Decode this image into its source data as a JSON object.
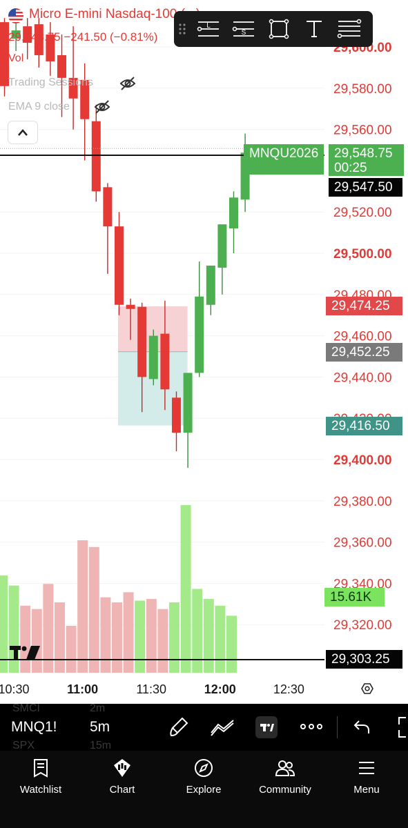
{
  "colors": {
    "up": "#4caf50",
    "down": "#e53935",
    "up_vol": "#a5ea8a",
    "down_vol": "#efb4b4",
    "axis_red": "#e03b36"
  },
  "legend": {
    "title": "Micro E-mini Nasdaq-100 (...)",
    "price_line": "29,548.75  −241.50 (−0.81%)",
    "vol": "Vol",
    "ind1": "Trading Sessions",
    "ind2": "EMA 9 close",
    "eye_icon": "eye-off-icon",
    "collapse_icon": "chevron-up-icon"
  },
  "toolbar_icons": [
    "grip-icon",
    "long-position-icon",
    "short-position-icon",
    "rectangle-icon",
    "text-icon",
    "fib-lines-icon"
  ],
  "chart_data": {
    "type": "candlestick",
    "price_axis": {
      "range": [
        29296,
        29614
      ],
      "ticks": [
        {
          "value": 29600,
          "label": "29,600.00",
          "bold": true
        },
        {
          "value": 29580,
          "label": "29,580.00",
          "bold": false
        },
        {
          "value": 29560,
          "label": "29,560.00",
          "bold": false
        },
        {
          "value": 29520,
          "label": "29,520.00",
          "bold": false
        },
        {
          "value": 29500,
          "label": "29,500.00",
          "bold": true
        },
        {
          "value": 29480,
          "label": "29,480.00",
          "bold": false
        },
        {
          "value": 29460,
          "label": "29,460.00",
          "bold": false
        },
        {
          "value": 29440,
          "label": "29,440.00",
          "bold": false
        },
        {
          "value": 29420,
          "label": "29,420.00",
          "bold": false
        },
        {
          "value": 29400,
          "label": "29,400.00",
          "bold": true
        },
        {
          "value": 29380,
          "label": "29,380.00",
          "bold": false
        },
        {
          "value": 29360,
          "label": "29,360.00",
          "bold": false
        },
        {
          "value": 29340,
          "label": "29,340.00",
          "bold": false
        },
        {
          "value": 29320,
          "label": "29,320.00",
          "bold": false
        }
      ]
    },
    "time_axis": [
      {
        "label": "10:30",
        "bold": false,
        "at": 0
      },
      {
        "label": "11:00",
        "bold": true,
        "at": 6
      },
      {
        "label": "11:30",
        "bold": false,
        "at": 12
      },
      {
        "label": "12:00",
        "bold": true,
        "at": 18
      },
      {
        "label": "12:30",
        "bold": false,
        "at": 24
      }
    ],
    "candles": [
      {
        "o": 29612,
        "h": 29614,
        "l": 29576,
        "c": 29581
      },
      {
        "o": 29604,
        "h": 29614,
        "l": 29598,
        "c": 29608
      },
      {
        "o": 29610,
        "h": 29614,
        "l": 29594,
        "c": 29602
      },
      {
        "o": 29611,
        "h": 29614,
        "l": 29590,
        "c": 29596
      },
      {
        "o": 29606,
        "h": 29612,
        "l": 29586,
        "c": 29593
      },
      {
        "o": 29596,
        "h": 29606,
        "l": 29566,
        "c": 29585
      },
      {
        "o": 29585,
        "h": 29610,
        "l": 29560,
        "c": 29575
      },
      {
        "o": 29584,
        "h": 29592,
        "l": 29545,
        "c": 29565
      },
      {
        "o": 29564,
        "h": 29572,
        "l": 29525,
        "c": 29530
      },
      {
        "o": 29532,
        "h": 29534,
        "l": 29490,
        "c": 29513
      },
      {
        "o": 29513,
        "h": 29520,
        "l": 29470,
        "c": 29475
      },
      {
        "o": 29475,
        "h": 29478,
        "l": 29458,
        "c": 29473
      },
      {
        "o": 29474,
        "h": 29476,
        "l": 29423,
        "c": 29440
      },
      {
        "o": 29439,
        "h": 29463,
        "l": 29436,
        "c": 29460
      },
      {
        "o": 29461,
        "h": 29477,
        "l": 29424,
        "c": 29434
      },
      {
        "o": 29430,
        "h": 29433,
        "l": 29404,
        "c": 29413
      },
      {
        "o": 29413,
        "h": 29441,
        "l": 29396,
        "c": 29442
      },
      {
        "o": 29442,
        "h": 29496,
        "l": 29440,
        "c": 29479
      },
      {
        "o": 29475,
        "h": 29492,
        "l": 29470,
        "c": 29494
      },
      {
        "o": 29493,
        "h": 29513,
        "l": 29480,
        "c": 29514
      },
      {
        "o": 29512,
        "h": 29530,
        "l": 29500,
        "c": 29527
      },
      {
        "o": 29526,
        "h": 29558,
        "l": 29520,
        "c": 29548.75
      }
    ],
    "volume": [
      {
        "v": 58,
        "up": true
      },
      {
        "v": 52,
        "up": true
      },
      {
        "v": 40,
        "up": false
      },
      {
        "v": 38,
        "up": false
      },
      {
        "v": 53,
        "up": false
      },
      {
        "v": 42,
        "up": false
      },
      {
        "v": 28,
        "up": false
      },
      {
        "v": 79,
        "up": false
      },
      {
        "v": 75,
        "up": false
      },
      {
        "v": 45,
        "up": false
      },
      {
        "v": 42,
        "up": false
      },
      {
        "v": 48,
        "up": false
      },
      {
        "v": 43,
        "up": true
      },
      {
        "v": 44,
        "up": false
      },
      {
        "v": 38,
        "up": false
      },
      {
        "v": 42,
        "up": true
      },
      {
        "v": 100,
        "up": true
      },
      {
        "v": 50,
        "up": true
      },
      {
        "v": 44,
        "up": true
      },
      {
        "v": 40,
        "up": true
      },
      {
        "v": 34,
        "up": true
      }
    ],
    "position_tool": {
      "entry": 29452.25,
      "target": 29474.25,
      "stop": 29416.5,
      "from_candle": 10,
      "to_candle": 16
    },
    "labels": {
      "symbol_tag": "MNQU2026",
      "last_price": "29,548.75",
      "countdown": "00:25",
      "crosshair_price": "29,547.50",
      "target_price": "29,474.25",
      "entry_price": "29,452.25",
      "stop_price": "29,416.50",
      "volume_value": "15.61K",
      "bottom_price": "29,303.25"
    },
    "crosshair_price_value": 29547.5,
    "bottom_price_value": 29303.25
  },
  "bottom_toolbar": {
    "symbol": "MNQ1!",
    "interval": "5m",
    "icons": [
      "brush-icon",
      "trend-line-icon",
      "tradingview-logo-icon",
      "more-icon",
      "undo-icon",
      "fullscreen-icon"
    ]
  },
  "ghost_list": [
    {
      "name": "SMCI",
      "val": "2m"
    },
    {
      "name": "SPX",
      "val": "15m"
    }
  ],
  "nav": {
    "items": [
      {
        "label": "Watchlist",
        "icon": "watchlist-icon"
      },
      {
        "label": "Chart",
        "icon": "chart-icon"
      },
      {
        "label": "Explore",
        "icon": "compass-icon"
      },
      {
        "label": "Community",
        "icon": "community-icon"
      },
      {
        "label": "Menu",
        "icon": "menu-icon"
      }
    ]
  }
}
